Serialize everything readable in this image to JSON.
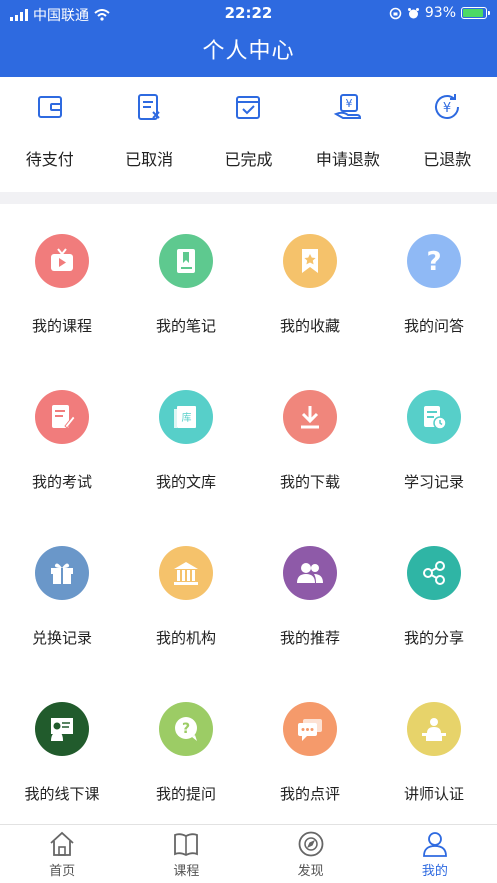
{
  "status_bar": {
    "carrier": "中国联通",
    "time": "22:22",
    "battery": "93%"
  },
  "header": {
    "title": "个人中心"
  },
  "orders": [
    {
      "label": "待支付",
      "icon": "wallet-icon"
    },
    {
      "label": "已取消",
      "icon": "cancelled-document-icon"
    },
    {
      "label": "已完成",
      "icon": "calendar-check-icon"
    },
    {
      "label": "申请退款",
      "icon": "refund-request-icon"
    },
    {
      "label": "已退款",
      "icon": "refunded-yen-icon"
    }
  ],
  "menu": [
    {
      "label": "我的课程",
      "icon": "tv-play-icon",
      "color": "#f17c7c"
    },
    {
      "label": "我的笔记",
      "icon": "notebook-pen-icon",
      "color": "#5ec98f"
    },
    {
      "label": "我的收藏",
      "icon": "bookmark-star-icon",
      "color": "#f5c26b"
    },
    {
      "label": "我的问答",
      "icon": "question-icon",
      "color": "#8fb9f5"
    },
    {
      "label": "我的考试",
      "icon": "exam-paper-icon",
      "color": "#f17c7c"
    },
    {
      "label": "我的文库",
      "icon": "library-book-icon",
      "color": "#57cfc9"
    },
    {
      "label": "我的下载",
      "icon": "download-icon",
      "color": "#f0867c"
    },
    {
      "label": "学习记录",
      "icon": "study-record-icon",
      "color": "#57cfc9"
    },
    {
      "label": "兑换记录",
      "icon": "gift-icon",
      "color": "#6a97c9"
    },
    {
      "label": "我的机构",
      "icon": "institution-icon",
      "color": "#f5c26b"
    },
    {
      "label": "我的推荐",
      "icon": "people-icon",
      "color": "#8e5aa8"
    },
    {
      "label": "我的分享",
      "icon": "share-icon",
      "color": "#2fb5a5"
    },
    {
      "label": "我的线下课",
      "icon": "teacher-board-icon",
      "color": "#215b2c"
    },
    {
      "label": "我的提问",
      "icon": "ask-bubble-icon",
      "color": "#9ccc65"
    },
    {
      "label": "我的点评",
      "icon": "comment-icon",
      "color": "#f59a6b"
    },
    {
      "label": "讲师认证",
      "icon": "lecturer-icon",
      "color": "#e7d36a"
    }
  ],
  "tabbar": [
    {
      "label": "首页",
      "icon": "home-icon",
      "active": false
    },
    {
      "label": "课程",
      "icon": "book-icon",
      "active": false
    },
    {
      "label": "发现",
      "icon": "compass-icon",
      "active": false
    },
    {
      "label": "我的",
      "icon": "user-icon",
      "active": true
    }
  ]
}
